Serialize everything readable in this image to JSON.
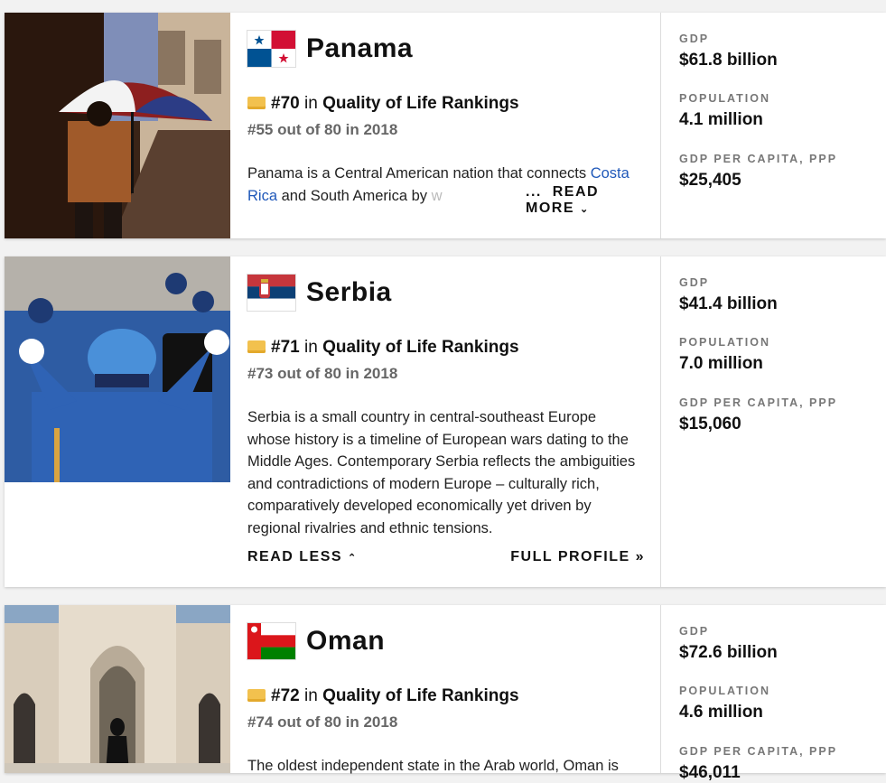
{
  "cards": [
    {
      "country": "Panama",
      "rank": "#70",
      "rank_in": "in",
      "ranking_name": "Quality of Life Rankings",
      "previous": "#55 out of 80 in 2018",
      "description_start": "Panama is a Central American nation that connects ",
      "description_link": "Costa Rica",
      "description_rest": " and South America by ",
      "description_fade": "w",
      "ellipsis": "...",
      "toggle_label": "READ MORE",
      "toggle_icon": "chevron-down-icon",
      "stats": {
        "gdp_label": "GDP",
        "gdp_value": "$61.8 billion",
        "population_label": "POPULATION",
        "population_value": "4.1 million",
        "gdp_pc_label": "GDP PER CAPITA, PPP",
        "gdp_pc_value": "$25,405"
      }
    },
    {
      "country": "Serbia",
      "rank": "#71",
      "rank_in": "in",
      "ranking_name": "Quality of Life Rankings",
      "previous": "#73 out of 80 in 2018",
      "description": "Serbia is a small country in central-southeast Europe whose history is a timeline of European wars dating to the Middle Ages. Contemporary Serbia reflects the ambiguities and contradictions of modern Europe – culturally rich, comparatively developed economically yet driven by regional rivalries and ethnic tensions.",
      "toggle_label": "READ LESS",
      "toggle_icon": "chevron-up-icon",
      "full_profile_label": "FULL PROFILE »",
      "stats": {
        "gdp_label": "GDP",
        "gdp_value": "$41.4 billion",
        "population_label": "POPULATION",
        "population_value": "7.0 million",
        "gdp_pc_label": "GDP PER CAPITA, PPP",
        "gdp_pc_value": "$15,060"
      }
    },
    {
      "country": "Oman",
      "rank": "#72",
      "rank_in": "in",
      "ranking_name": "Quality of Life Rankings",
      "previous": "#74 out of 80 in 2018",
      "description": "The oldest independent state in the Arab world, Oman is",
      "stats": {
        "gdp_label": "GDP",
        "gdp_value": "$72.6 billion",
        "population_label": "POPULATION",
        "population_value": "4.6 million",
        "gdp_pc_label": "GDP PER CAPITA, PPP",
        "gdp_pc_value": "$46,011"
      }
    }
  ],
  "colors": {
    "link": "#1f58b9",
    "badge": "#f2c14e"
  }
}
